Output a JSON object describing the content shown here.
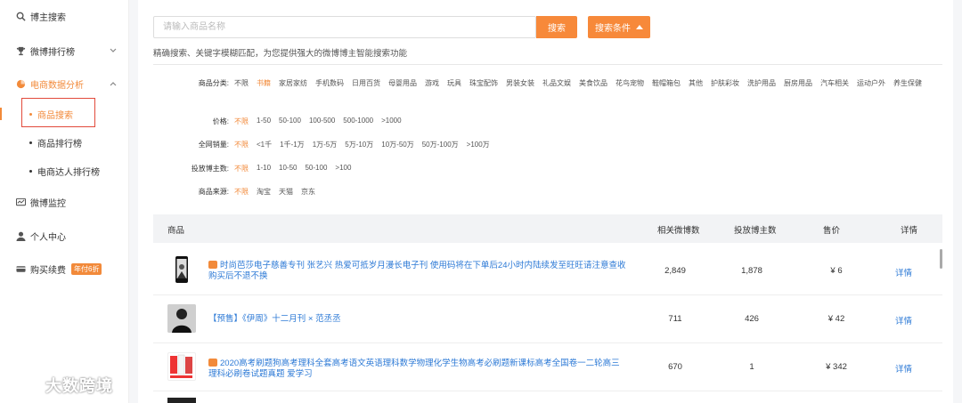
{
  "sidebar": {
    "items": [
      {
        "label": "博主搜索",
        "icon": "search-icon"
      },
      {
        "label": "微博排行榜",
        "icon": "trophy-icon"
      },
      {
        "label": "电商数据分析",
        "icon": "analytics-icon"
      },
      {
        "label": "微博监控",
        "icon": "monitor-icon"
      },
      {
        "label": "个人中心",
        "icon": "user-icon"
      },
      {
        "label": "购买续费",
        "icon": "card-icon",
        "badge": "年付6折"
      }
    ],
    "sub_items": [
      "商品搜索",
      "商品排行榜",
      "电商达人排行榜"
    ],
    "accent_color": "#f28a3a"
  },
  "search": {
    "placeholder": "请输入商品名称",
    "button_label": "搜索",
    "conditions_label": "搜索条件",
    "hint": "精确搜索、关键字模糊匹配，为您提供强大的微博博主智能搜索功能"
  },
  "filters": [
    {
      "label": "商品分类:",
      "options": [
        "不限",
        "书籍",
        "家居家纺",
        "手机数码",
        "日用百货",
        "母婴用品",
        "游戏",
        "玩具",
        "珠宝配饰",
        "男装女装",
        "礼品文娱",
        "美食饮品",
        "花鸟宠物",
        "鞋帽箱包",
        "其他",
        "护肤彩妆",
        "洗护用品",
        "厨房用品",
        "汽车相关",
        "运动户外",
        "养生保健"
      ],
      "selected": 1
    },
    {
      "label": "价格:",
      "options": [
        "不限",
        "1-50",
        "50-100",
        "100-500",
        "500-1000",
        ">1000"
      ],
      "selected": 0
    },
    {
      "label": "全网销量:",
      "options": [
        "不限",
        "<1千",
        "1千-1万",
        "1万-5万",
        "5万-10万",
        "10万-50万",
        "50万-100万",
        ">100万"
      ],
      "selected": 0
    },
    {
      "label": "投放博主数:",
      "options": [
        "不限",
        "1-10",
        "10-50",
        "50-100",
        ">100"
      ],
      "selected": 0
    },
    {
      "label": "商品来源:",
      "options": [
        "不限",
        "淘宝",
        "天猫",
        "京东"
      ],
      "selected": 0
    }
  ],
  "table": {
    "headers": {
      "product": "商品",
      "weibo_count": "相关微博数",
      "blogger_count": "投放博主数",
      "price": "售价",
      "detail": "详情"
    },
    "rows": [
      {
        "title": "时尚芭莎电子慈善专刊 张艺兴 热爱可抵岁月漫长电子刊 使用码将在下单后24小时内陆续发至旺旺请注意查收 购买后不退不换",
        "tmall": true,
        "weibo_count": "2,849",
        "blogger_count": "1,878",
        "price": "¥ 6",
        "detail": "详情"
      },
      {
        "title": "【预售】《伊周》十二月刊 × 范丞丞",
        "tmall": false,
        "weibo_count": "711",
        "blogger_count": "426",
        "price": "¥ 42",
        "detail": "详情"
      },
      {
        "title": "2020高考刷题狗高考理科全套高考语文英语理科数学物理化学生物高考必刷题新课标高考全国卷一二轮高三理科必刷卷试题真题 爱学习",
        "tmall": true,
        "weibo_count": "670",
        "blogger_count": "1",
        "price": "¥ 342",
        "detail": "详情"
      }
    ]
  },
  "watermark": "大数跨境"
}
